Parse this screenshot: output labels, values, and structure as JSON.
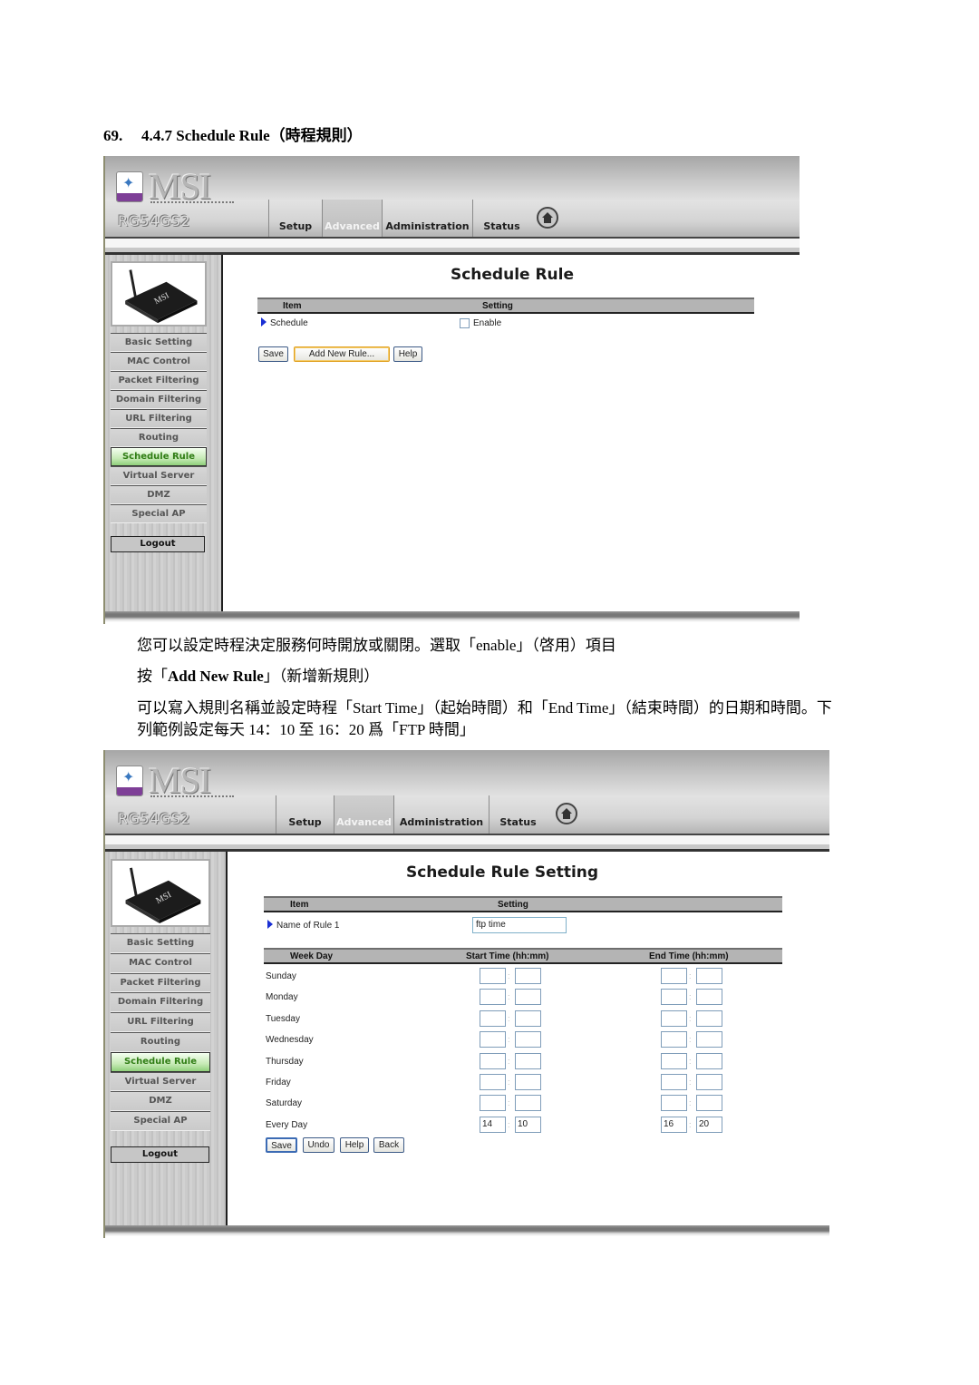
{
  "document": {
    "section_number": "69.",
    "section_title": "4.4.7 Schedule Rule（時程規則）",
    "paragraph_1": "您可以設定時程決定服務何時開放或關閉。選取「enable」（啓用）項目",
    "paragraph_2_prefix": "按「",
    "paragraph_2_bold": "Add New Rule",
    "paragraph_2_suffix": "」（新增新規則）",
    "paragraph_3_line1": "可以寫入規則名稱並設定時程「Start Time」（起始時間）和「End Time」（結束時間）的日期和時間。下",
    "paragraph_3_line2": "列範例設定每天 14：10 至 16：20 爲「FTP 時間」"
  },
  "router_ui": {
    "brand": "MSI",
    "model": "RG54GS2",
    "tabs": [
      {
        "label": "Setup",
        "active": false
      },
      {
        "label": "Advanced",
        "active": true
      },
      {
        "label": "Administration",
        "active": false
      },
      {
        "label": "Status",
        "active": false
      }
    ],
    "home_icon": "home-icon",
    "sidebar": {
      "items": [
        {
          "label": "Basic Setting",
          "active": false
        },
        {
          "label": "MAC Control",
          "active": false
        },
        {
          "label": "Packet Filtering",
          "active": false
        },
        {
          "label": "Domain Filtering",
          "active": false
        },
        {
          "label": "URL Filtering",
          "active": false
        },
        {
          "label": "Routing",
          "active": false
        },
        {
          "label": "Schedule Rule",
          "active": true
        },
        {
          "label": "Virtual Server",
          "active": false
        },
        {
          "label": "DMZ",
          "active": false
        },
        {
          "label": "Special AP",
          "active": false
        }
      ],
      "logout_label": "Logout"
    },
    "colors": {
      "active_menu_text": "#2f7d14",
      "arrow_blue": "#1a2fd4",
      "header_gray": "#b4b4b4"
    }
  },
  "screen1": {
    "title": "Schedule Rule",
    "col_item": "Item",
    "col_setting": "Setting",
    "row_label": "Schedule",
    "checkbox_label": "Enable",
    "checkbox_checked": false,
    "buttons": {
      "save": "Save",
      "add_new_rule": "Add New Rule...",
      "help": "Help"
    }
  },
  "screen2": {
    "title": "Schedule Rule Setting",
    "col_item": "Item",
    "col_setting": "Setting",
    "name_label": "Name of Rule 1",
    "name_value": "ftp time",
    "col_weekday": "Week Day",
    "col_start": "Start Time (hh:mm)",
    "col_end": "End Time (hh:mm)",
    "days": [
      {
        "day": "Sunday",
        "start_hh": "",
        "start_mm": "",
        "end_hh": "",
        "end_mm": ""
      },
      {
        "day": "Monday",
        "start_hh": "",
        "start_mm": "",
        "end_hh": "",
        "end_mm": ""
      },
      {
        "day": "Tuesday",
        "start_hh": "",
        "start_mm": "",
        "end_hh": "",
        "end_mm": ""
      },
      {
        "day": "Wednesday",
        "start_hh": "",
        "start_mm": "",
        "end_hh": "",
        "end_mm": ""
      },
      {
        "day": "Thursday",
        "start_hh": "",
        "start_mm": "",
        "end_hh": "",
        "end_mm": ""
      },
      {
        "day": "Friday",
        "start_hh": "",
        "start_mm": "",
        "end_hh": "",
        "end_mm": ""
      },
      {
        "day": "Saturday",
        "start_hh": "",
        "start_mm": "",
        "end_hh": "",
        "end_mm": ""
      },
      {
        "day": "Every Day",
        "start_hh": "14",
        "start_mm": "10",
        "end_hh": "16",
        "end_mm": "20"
      }
    ],
    "colon": ":",
    "buttons": {
      "save": "Save",
      "undo": "Undo",
      "help": "Help",
      "back": "Back"
    }
  }
}
